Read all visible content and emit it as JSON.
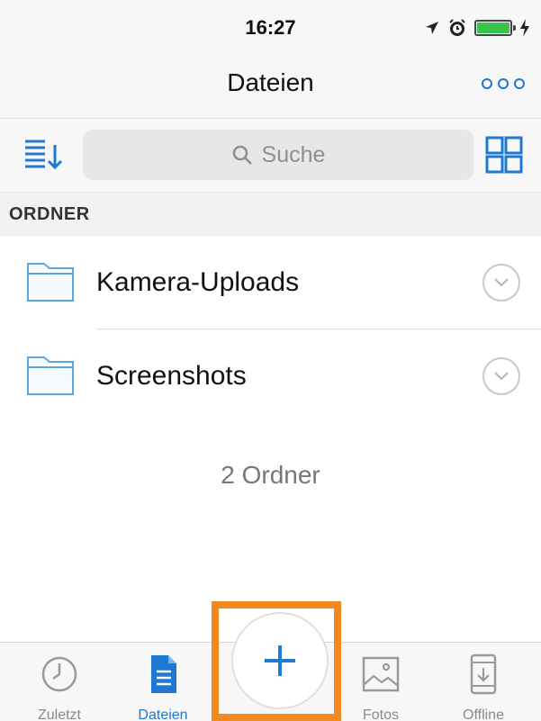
{
  "status_bar": {
    "time": "16:27",
    "icons": [
      "location-icon",
      "alarm-icon",
      "battery-icon",
      "charging-icon"
    ],
    "battery_color": "#37c44d"
  },
  "nav": {
    "title": "Dateien",
    "more_icon": "more-icon",
    "accent_color": "#1f78d1"
  },
  "search": {
    "placeholder": "Suche",
    "sort_icon": "sort-icon",
    "search_icon": "search-icon",
    "grid_icon": "grid-view-icon"
  },
  "section": {
    "title": "ORDNER"
  },
  "folders": [
    {
      "name": "Kamera-Uploads",
      "icon": "folder-icon",
      "menu_icon": "chevron-down-icon"
    },
    {
      "name": "Screenshots",
      "icon": "folder-icon",
      "menu_icon": "chevron-down-icon"
    }
  ],
  "summary": {
    "folder_count": "2 Ordner"
  },
  "tabs": [
    {
      "label": "Zuletzt",
      "icon": "clock-icon",
      "active": false
    },
    {
      "label": "Dateien",
      "icon": "document-icon",
      "active": true
    },
    {
      "label": "Fotos",
      "icon": "photo-icon",
      "active": false
    },
    {
      "label": "Offline",
      "icon": "offline-device-icon",
      "active": false
    }
  ],
  "fab": {
    "icon": "plus-icon",
    "highlight_color": "#f2891f"
  }
}
